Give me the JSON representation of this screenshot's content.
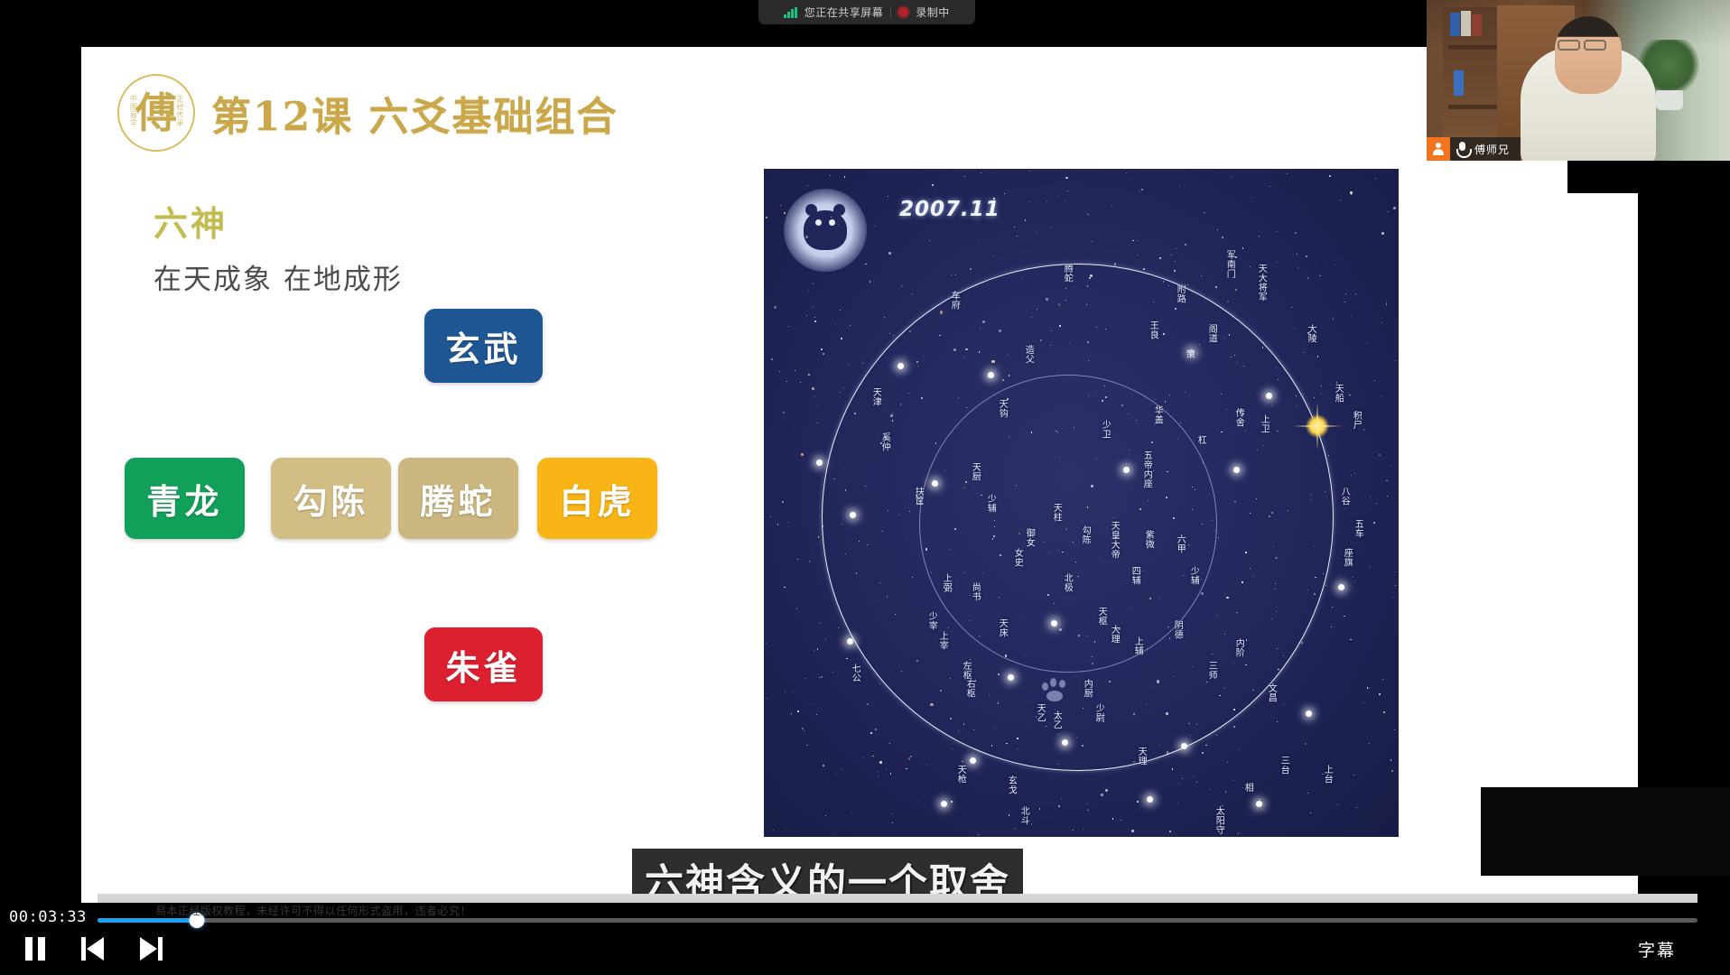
{
  "status_bar": {
    "signal_icon": "signal-bars-icon",
    "sharing_text": "您正在共享屏幕",
    "recording_icon": "record-dot-icon",
    "recording_text": "录制中"
  },
  "slide": {
    "seal": {
      "center_char": "傅",
      "left_col": "中国易学",
      "right_col": "正经传承"
    },
    "title": "第12课 六爻基础组合",
    "section_heading": "六神",
    "section_subtitle": "在天成象 在地成形",
    "boxes": [
      {
        "label": "玄武",
        "color": "#1f5795",
        "text_color": "#ffffff",
        "position": "top-center"
      },
      {
        "label": "青龙",
        "color": "#11a05a",
        "text_color": "#ffffff",
        "position": "middle-1"
      },
      {
        "label": "勾陈",
        "color": "#d2bd85",
        "text_color": "#ffffff",
        "position": "middle-2"
      },
      {
        "label": "腾蛇",
        "color": "#cbb77f",
        "text_color": "#ffffff",
        "position": "middle-3"
      },
      {
        "label": "白虎",
        "color": "#f9b515",
        "text_color": "#ffffff",
        "position": "middle-4"
      },
      {
        "label": "朱雀",
        "color": "#dc2030",
        "text_color": "#ffffff",
        "position": "bottom-center"
      }
    ]
  },
  "star_chart": {
    "date_label": "2007.11",
    "logo": "moon-toad-icon",
    "watermark": "baidu-paw-icon",
    "constellation_labels": [
      "腾蛇",
      "车府",
      "附路",
      "军南门",
      "天大将军",
      "王良",
      "阁道",
      "策",
      "大陵",
      "天船",
      "积尸",
      "天津",
      "奚仲",
      "造父",
      "天钩",
      "华盖",
      "杠",
      "传舍",
      "上卫",
      "少卫",
      "五帝内座",
      "八谷",
      "五车",
      "扶筐",
      "天厨",
      "少辅",
      "天柱",
      "御女",
      "女史",
      "勾陈",
      "天皇大帝",
      "紫微",
      "六甲",
      "座旗",
      "上弼",
      "尚书",
      "北极",
      "四辅",
      "天枢",
      "大理",
      "阴德",
      "少辅",
      "内阶",
      "三师",
      "文昌",
      "少宰",
      "上宰",
      "天床",
      "左枢",
      "右枢",
      "七公",
      "天乙",
      "太乙",
      "内厨",
      "少尉",
      "上辅",
      "天理",
      "天枪",
      "玄戈",
      "三台",
      "上台",
      "北斗",
      "太阳守",
      "相"
    ]
  },
  "caption": {
    "text": "六神含义的一个取舍"
  },
  "webcam": {
    "participant_name": "傅师兄",
    "avatar_icon": "user-avatar-icon",
    "mic_icon": "microphone-icon"
  },
  "player": {
    "timecode": "00:03:33",
    "progress_percent": 6.2,
    "pause_label": "pause-icon",
    "prev_label": "previous-icon",
    "next_label": "next-icon",
    "subtitle_button": "字幕",
    "watermark": "易本正经版权教程，未经许可不得以任何形式盗用，违者必究！"
  },
  "colors": {
    "accent_blue": "#1fa2f2",
    "gold": "#c9a74a",
    "slide_bg": "#ffffff",
    "chart_bg": "#242a5f"
  }
}
